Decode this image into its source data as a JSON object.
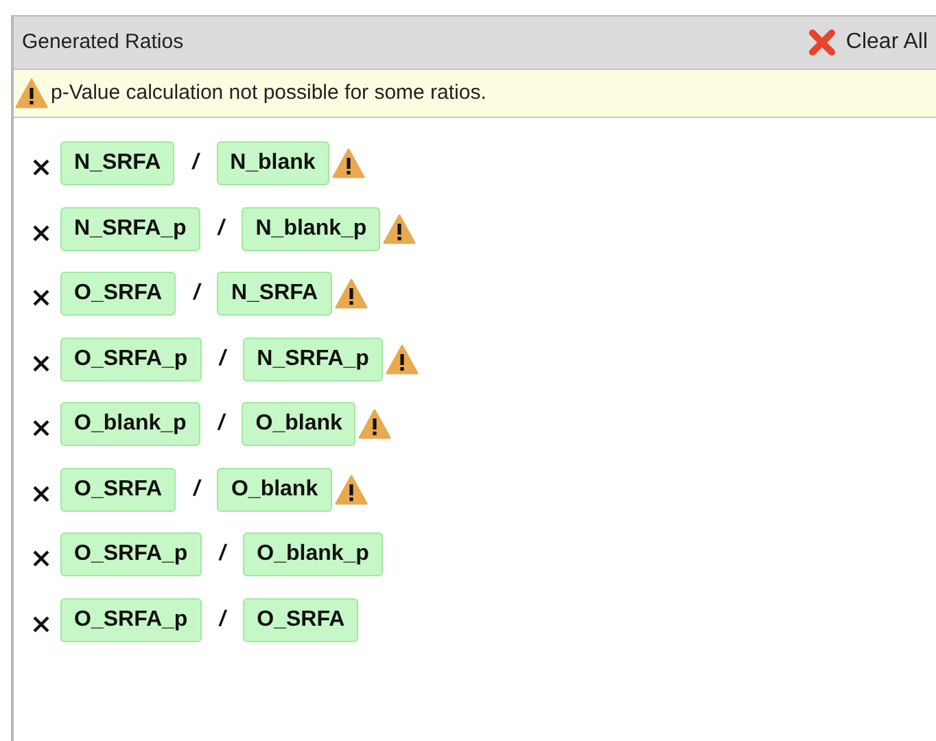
{
  "panel": {
    "title": "Generated Ratios",
    "clear_button": "Clear All"
  },
  "warning": {
    "message": "p-Value calculation not possible for some ratios."
  },
  "ratios": [
    {
      "numerator": "N_SRFA",
      "separator": "/",
      "denominator": "N_blank",
      "warning": true
    },
    {
      "numerator": "N_SRFA_p",
      "separator": "/",
      "denominator": "N_blank_p",
      "warning": true
    },
    {
      "numerator": "O_SRFA",
      "separator": "/",
      "denominator": "N_SRFA",
      "warning": true
    },
    {
      "numerator": "O_SRFA_p",
      "separator": "/",
      "denominator": "N_SRFA_p",
      "warning": true
    },
    {
      "numerator": "O_blank_p",
      "separator": "/",
      "denominator": "O_blank",
      "warning": true
    },
    {
      "numerator": "O_SRFA",
      "separator": "/",
      "denominator": "O_blank",
      "warning": true
    },
    {
      "numerator": "O_SRFA_p",
      "separator": "/",
      "denominator": "O_blank_p",
      "warning": false
    },
    {
      "numerator": "O_SRFA_p",
      "separator": "/",
      "denominator": "O_SRFA",
      "warning": false
    }
  ]
}
